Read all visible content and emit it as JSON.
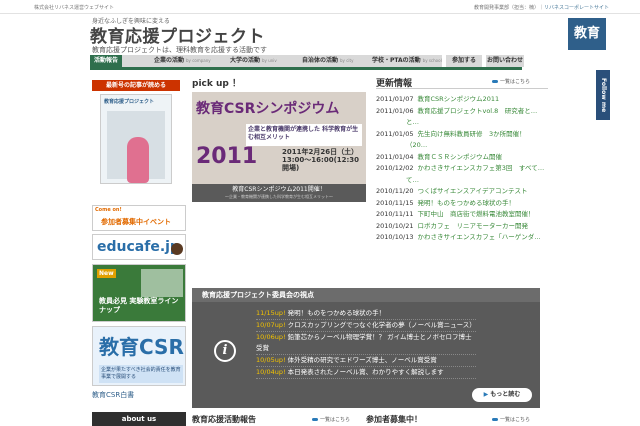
{
  "topbar": {
    "left": "株式会社リバネス運営ウェブサイト",
    "right_prefix": "教育開発事業部（担当：楠）｜",
    "right_link": "リバネスコーポレートサイト"
  },
  "header": {
    "tagline": "身近なふしぎを興味に変える",
    "title": "教育応援プロジェクト",
    "subtitle": "教育応援プロジェクトは、理科教育を応援する活動です",
    "emblem": "教育"
  },
  "nav": {
    "items": [
      {
        "label": "活動報告",
        "sub": ""
      },
      {
        "label": "企業の活動",
        "sub": "by company"
      },
      {
        "label": "大学の活動",
        "sub": "by univ"
      },
      {
        "label": "自治体の活動",
        "sub": "by city"
      },
      {
        "label": "学校・PTAの活動",
        "sub": "by school"
      }
    ],
    "join": "参加する",
    "contact": "お問い合わせ"
  },
  "sidebar": {
    "latest": "最新号の記事が読める",
    "magazine_head": "教育応援プロジェクト",
    "event_tag": "Come on!",
    "event": "参加者募集中イベント",
    "educafe": "educafe.jp",
    "lab_new": "New",
    "lab_text": "教員必見 実験教室ラインナップ",
    "csr_big": "教育CSR",
    "csr_text": "企業が果たすべき社会的責任を教育事業で展開する",
    "csr_link": "教育CSR白書",
    "about": "about us"
  },
  "pickup": {
    "title": "pick up ！",
    "headline": "教育CSRシンポジウム",
    "year": "2011",
    "box": "企業と教育機関が連携した 科学教育が生む相互メリット",
    "date": "2011年2月26日（土） 13:00〜16:00(12:30開場)",
    "caption": "教育CSRシンポジウム2011開催！",
    "caption_sub": "〜企業・教育機関が連携した科学教育が生む相互メリット〜"
  },
  "news": {
    "title": "更新情報",
    "more": "一覧はこちら",
    "items": [
      {
        "date": "2011/01/07",
        "text": "教育CSRシンポジウム2011"
      },
      {
        "date": "2011/01/06",
        "text": "教育応援プロジェクトvol.8　研究者と…"
      },
      {
        "date": "",
        "text": "と…"
      },
      {
        "date": "2011/01/05",
        "text": "先生向け無料教員研修　3か所開催！"
      },
      {
        "date": "",
        "text": "（20…"
      },
      {
        "date": "2011/01/04",
        "text": "教育ＣＳＲシンポジウム開催"
      },
      {
        "date": "2010/12/02",
        "text": "かわさきサイエンスカフェ第3回　すべて…"
      },
      {
        "date": "",
        "text": "て…"
      },
      {
        "date": "2010/11/20",
        "text": "つくばサイエンスアイデアコンテスト"
      },
      {
        "date": "2010/11/15",
        "text": "発明！ものをつかめる球状の手！"
      },
      {
        "date": "2010/11/11",
        "text": "下町中山　商店街で燃料電池教室開催！"
      },
      {
        "date": "2010/10/21",
        "text": "ロボカフェ　リニアモーターカー開発"
      },
      {
        "date": "2010/10/13",
        "text": "かわさきサイエンスカフェ「ハーゲンダ…"
      }
    ]
  },
  "committee": {
    "title": "教育応援プロジェクト委員会の視点",
    "items": [
      {
        "date": "11/15up!",
        "text": "発明！ものをつかめる球状の手！"
      },
      {
        "date": "10/07up!",
        "text": "クロスカップリングでつなぐ化学者の夢（ノーベル賞ニュース）"
      },
      {
        "date": "10/06up!",
        "text": "鉛筆芯からノーベル物理学賞！？ ガイム博士とノボセロフ博士受賞"
      },
      {
        "date": "10/05up!",
        "text": "体外受精の研究でエドワーズ博士、ノーベル賞受賞"
      },
      {
        "date": "10/04up!",
        "text": "本日発表されたノーベル賞、わかりやすく解説します"
      }
    ],
    "more": "もっと読む"
  },
  "bottom": {
    "report": "教育応援活動報告",
    "report_more": "一覧はこちら",
    "recruit": "参加者募集中！",
    "recruit_more": "一覧はこちら"
  },
  "followme": "Follow me"
}
